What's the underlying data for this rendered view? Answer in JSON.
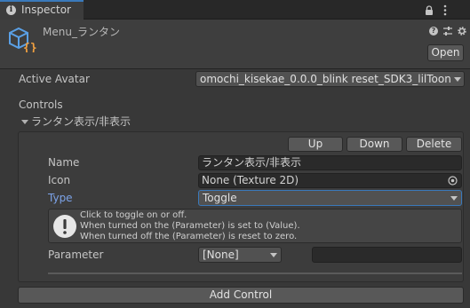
{
  "tab": {
    "title": "Inspector"
  },
  "header": {
    "component_name": "Menu_ランタン",
    "open_label": "Open"
  },
  "active_avatar": {
    "label": "Active Avatar",
    "value": "omochi_kisekae_0.0.0_blink reset_SDK3_lilToon"
  },
  "controls": {
    "section_label": "Controls",
    "item_title": "ランタン表示/非表示",
    "buttons": {
      "up": "Up",
      "down": "Down",
      "delete": "Delete"
    },
    "fields": {
      "name_label": "Name",
      "name_value": "ランタン表示/非表示",
      "icon_label": "Icon",
      "icon_value": "None (Texture 2D)",
      "type_label": "Type",
      "type_value": "Toggle"
    },
    "help": {
      "line1": "Click to toggle on or off.",
      "line2": "When turned on the (Parameter) is set to (Value).",
      "line3": "When turned off the (Parameter) is reset to zero."
    },
    "parameter": {
      "label": "Parameter",
      "value": "[None]",
      "extra_value": ""
    },
    "add_control_label": "Add Control"
  },
  "colors": {
    "accent": "#3a79bb",
    "type_label": "#7ca3e8",
    "background": "#383838"
  }
}
